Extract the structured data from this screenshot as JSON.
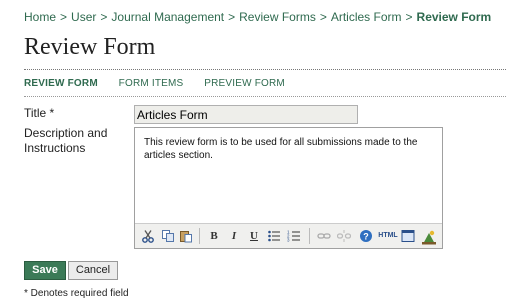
{
  "breadcrumb": {
    "items": [
      "Home",
      "User",
      "Journal Management",
      "Review Forms",
      "Articles Form"
    ],
    "current": "Review Form",
    "separator": ">"
  },
  "page": {
    "title": "Review Form"
  },
  "tabs": [
    {
      "label": "REVIEW FORM",
      "active": true
    },
    {
      "label": "FORM ITEMS",
      "active": false
    },
    {
      "label": "PREVIEW FORM",
      "active": false
    }
  ],
  "form": {
    "title_label": "Title *",
    "title_value": "Articles Form",
    "description_label_line1": "Description and",
    "description_label_line2": "Instructions",
    "description_value": "This review form is to be used for all submissions made to the articles section."
  },
  "toolbar": {
    "icons": [
      "cut-icon",
      "copy-icon",
      "paste-icon",
      "bold-icon",
      "italic-icon",
      "underline-icon",
      "bullet-list-icon",
      "numbered-list-icon",
      "link-icon",
      "unlink-icon",
      "help-icon",
      "html-icon",
      "fullscreen-icon",
      "image-icon"
    ],
    "bold": "B",
    "italic": "I",
    "underline": "U",
    "html": "HTML",
    "help": "?"
  },
  "buttons": {
    "save": "Save",
    "cancel": "Cancel"
  },
  "note": "* Denotes required field",
  "colors": {
    "accent": "#2f6a4f",
    "save_button": "#3b7a57"
  }
}
